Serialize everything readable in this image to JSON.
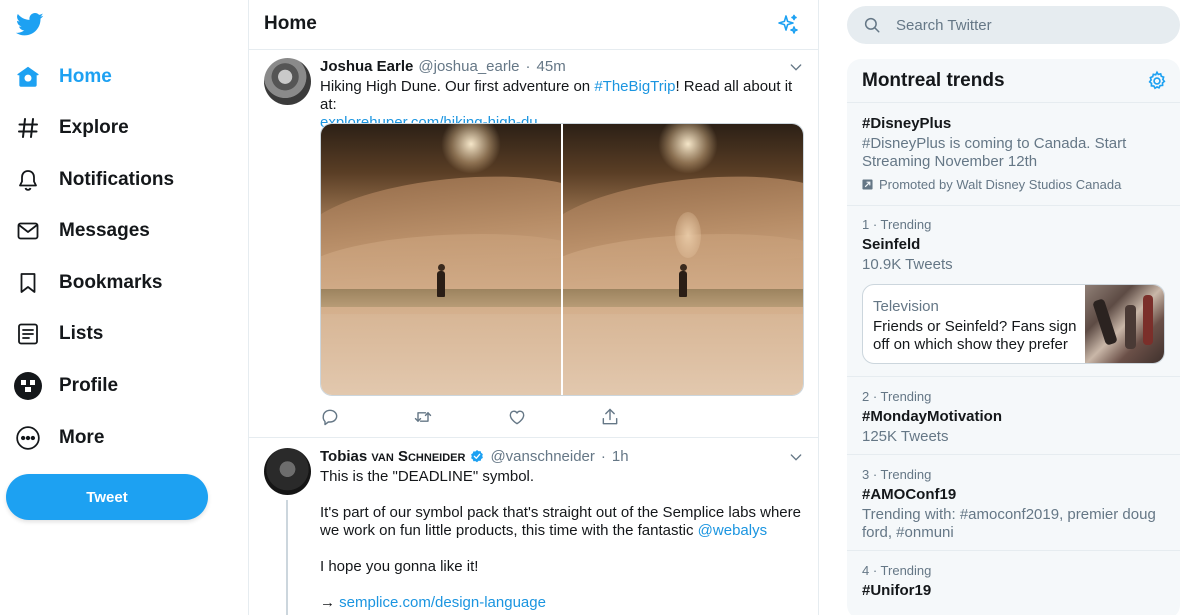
{
  "nav": {
    "items": [
      {
        "label": "Home",
        "icon": "home-icon",
        "active": true
      },
      {
        "label": "Explore",
        "icon": "hashtag-icon"
      },
      {
        "label": "Notifications",
        "icon": "bell-icon"
      },
      {
        "label": "Messages",
        "icon": "envelope-icon"
      },
      {
        "label": "Bookmarks",
        "icon": "bookmark-icon"
      },
      {
        "label": "Lists",
        "icon": "list-icon"
      },
      {
        "label": "Profile",
        "icon": "profile-icon"
      },
      {
        "label": "More",
        "icon": "more-icon"
      }
    ],
    "tweet_button": "Tweet"
  },
  "header": {
    "title": "Home"
  },
  "tweets": [
    {
      "name": "Joshua Earle",
      "handle": "@joshua_earle",
      "time": "45m",
      "text_before": "Hiking High Dune. Our first adventure on ",
      "hashtag": "#TheBigTrip",
      "text_after": "! Read all about it at:",
      "link": "explorehuper.com/hiking-high-du..."
    },
    {
      "name": "Tobias ",
      "name_smallcaps": "van Schneider",
      "handle": "@vanschneider",
      "time": "1h",
      "line1": "This is the \"DEADLINE\" symbol.",
      "line2": "It's part of our symbol pack that's straight out of the Semplice labs where we work on fun little products, this time with the fantastic ",
      "mention": "@webalys",
      "line3": "I hope you gonna like it!",
      "arrow": "→ ",
      "link": "semplice.com/design-language"
    }
  ],
  "search": {
    "placeholder": "Search Twitter"
  },
  "trends": {
    "title": "Montreal trends",
    "promoted": {
      "tag": "#DisneyPlus",
      "desc": "#DisneyPlus is coming to Canada. Start Streaming November 12th",
      "by": "Promoted by Walt Disney Studios Canada"
    },
    "items": [
      {
        "rank": "1 · Trending",
        "name": "Seinfeld",
        "count": "10.9K Tweets"
      },
      {
        "rank": "2 · Trending",
        "name": "#MondayMotivation",
        "count": "125K Tweets"
      },
      {
        "rank": "3 · Trending",
        "name": "#AMOConf19",
        "count": "Trending with: #amoconf2019, premier doug ford, #onmuni"
      },
      {
        "rank": "4 · Trending",
        "name": "#Unifor19",
        "count": ""
      }
    ],
    "card": {
      "category": "Television",
      "text": "Friends or Seinfeld? Fans sign off on which show they prefer"
    }
  },
  "colors": {
    "accent": "#1da1f2",
    "link": "#1b95e0",
    "muted": "#657786",
    "border": "#e6ecf0"
  }
}
